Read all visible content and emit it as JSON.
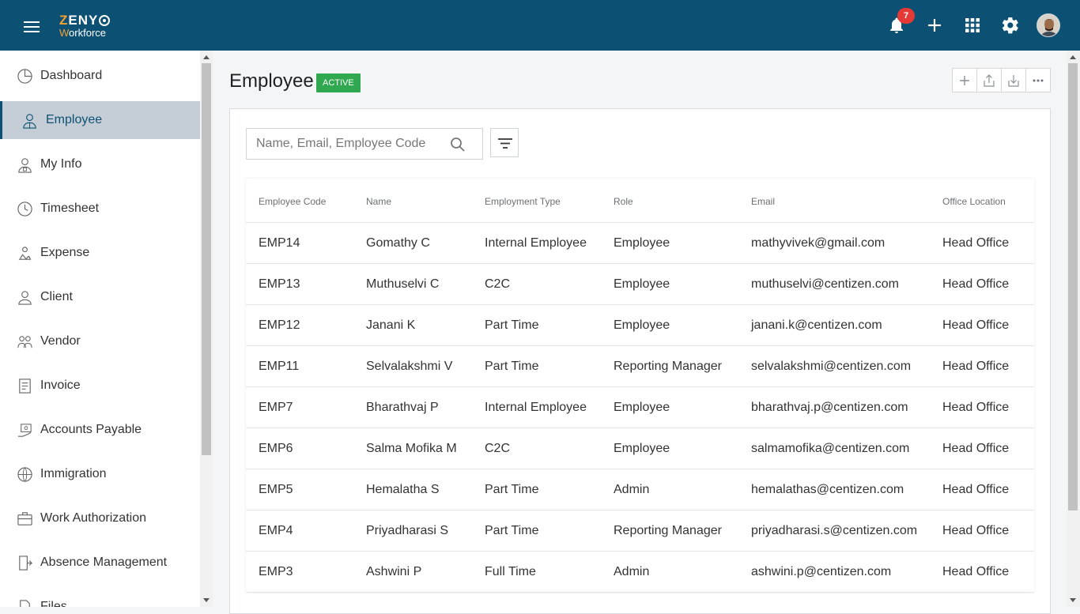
{
  "app": {
    "logo_top": "ZENY",
    "logo_sub": "Workforce",
    "notification_count": "7"
  },
  "sidebar": {
    "items": [
      {
        "label": "Dashboard",
        "icon": "dashboard-icon"
      },
      {
        "label": "Employee",
        "icon": "employee-icon",
        "active": true
      },
      {
        "label": "My Info",
        "icon": "my-info-icon"
      },
      {
        "label": "Timesheet",
        "icon": "timesheet-icon"
      },
      {
        "label": "Expense",
        "icon": "expense-icon"
      },
      {
        "label": "Client",
        "icon": "client-icon"
      },
      {
        "label": "Vendor",
        "icon": "vendor-icon"
      },
      {
        "label": "Invoice",
        "icon": "invoice-icon"
      },
      {
        "label": "Accounts Payable",
        "icon": "accounts-payable-icon"
      },
      {
        "label": "Immigration",
        "icon": "immigration-icon"
      },
      {
        "label": "Work Authorization",
        "icon": "work-authorization-icon"
      },
      {
        "label": "Absence Management",
        "icon": "absence-management-icon"
      },
      {
        "label": "Files",
        "icon": "files-icon"
      }
    ]
  },
  "page": {
    "title": "Employee",
    "status": "ACTIVE"
  },
  "search": {
    "placeholder": "Name, Email, Employee Code",
    "value": ""
  },
  "table": {
    "headers": [
      "Employee Code",
      "Name",
      "Employment Type",
      "Role",
      "Email",
      "Office Location"
    ],
    "rows": [
      [
        "EMP14",
        "Gomathy C",
        "Internal Employee",
        "Employee",
        "mathyvivek@gmail.com",
        "Head Office"
      ],
      [
        "EMP13",
        "Muthuselvi C",
        "C2C",
        "Employee",
        "muthuselvi@centizen.com",
        "Head Office"
      ],
      [
        "EMP12",
        "Janani K",
        "Part Time",
        "Employee",
        "janani.k@centizen.com",
        "Head Office"
      ],
      [
        "EMP11",
        "Selvalakshmi V",
        "Part Time",
        "Reporting Manager",
        "selvalakshmi@centizen.com",
        "Head Office"
      ],
      [
        "EMP7",
        "Bharathvaj P",
        "Internal Employee",
        "Employee",
        "bharathvaj.p@centizen.com",
        "Head Office"
      ],
      [
        "EMP6",
        "Salma Mofika M",
        "C2C",
        "Employee",
        "salmamofika@centizen.com",
        "Head Office"
      ],
      [
        "EMP5",
        "Hemalatha S",
        "Part Time",
        "Admin",
        "hemalathas@centizen.com",
        "Head Office"
      ],
      [
        "EMP4",
        "Priyadharasi S",
        "Part Time",
        "Reporting Manager",
        "priyadharasi.s@centizen.com",
        "Head Office"
      ],
      [
        "EMP3",
        "Ashwini P",
        "Full Time",
        "Admin",
        "ashwini.p@centizen.com",
        "Head Office"
      ]
    ]
  },
  "colors": {
    "topbar": "#0c5173",
    "accent": "#f4a233",
    "status_active": "#2fa84f",
    "badge": "#e53935",
    "sidebar_active": "#c5ced6"
  }
}
